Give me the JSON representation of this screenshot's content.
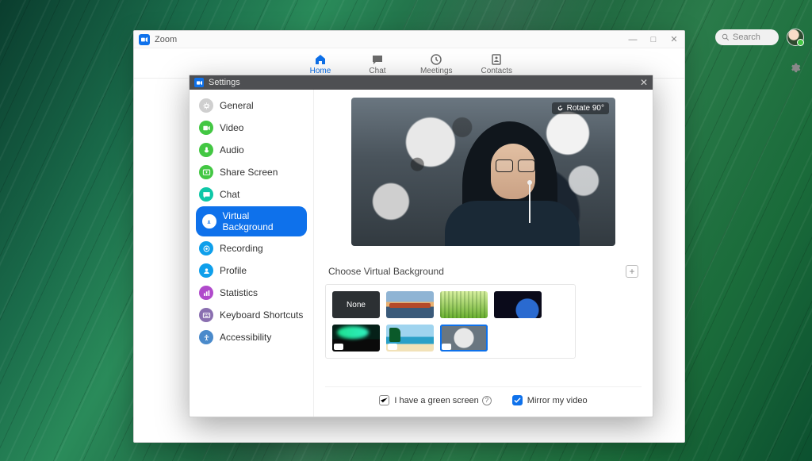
{
  "app": {
    "title": "Zoom"
  },
  "window_controls": {
    "minimize": "—",
    "maximize": "□",
    "close": "✕"
  },
  "nav": {
    "tabs": [
      {
        "id": "home",
        "label": "Home",
        "active": true
      },
      {
        "id": "chat",
        "label": "Chat"
      },
      {
        "id": "meetings",
        "label": "Meetings"
      },
      {
        "id": "contacts",
        "label": "Contacts"
      }
    ],
    "search_placeholder": "Search"
  },
  "settings": {
    "title": "Settings",
    "sidebar": [
      {
        "id": "general",
        "label": "General",
        "color": "#cfcfcf"
      },
      {
        "id": "video",
        "label": "Video",
        "color": "#43c743"
      },
      {
        "id": "audio",
        "label": "Audio",
        "color": "#43c743"
      },
      {
        "id": "share-screen",
        "label": "Share Screen",
        "color": "#43c743"
      },
      {
        "id": "chat",
        "label": "Chat",
        "color": "#0ec7a7"
      },
      {
        "id": "virtual-background",
        "label": "Virtual Background",
        "color": "#0e71eb",
        "selected": true
      },
      {
        "id": "recording",
        "label": "Recording",
        "color": "#0e9feb"
      },
      {
        "id": "profile",
        "label": "Profile",
        "color": "#0e9feb"
      },
      {
        "id": "statistics",
        "label": "Statistics",
        "color": "#b04acb"
      },
      {
        "id": "keyboard-shortcuts",
        "label": "Keyboard Shortcuts",
        "color": "#8a6fb0"
      },
      {
        "id": "accessibility",
        "label": "Accessibility",
        "color": "#4a8acb"
      }
    ],
    "preview": {
      "rotate_label": "Rotate 90°"
    },
    "choose_label": "Choose Virtual Background",
    "thumbs": [
      {
        "id": "none",
        "label": "None",
        "kind": "none"
      },
      {
        "id": "bridge",
        "kind": "bridge"
      },
      {
        "id": "grass",
        "kind": "grass"
      },
      {
        "id": "earth",
        "kind": "earth"
      },
      {
        "id": "aurora",
        "kind": "aurora",
        "camera": true
      },
      {
        "id": "beach",
        "kind": "beach",
        "camera": true
      },
      {
        "id": "blossom",
        "kind": "blossom",
        "camera": true,
        "selected": true
      }
    ],
    "footer": {
      "green_screen": {
        "label": "I have a green screen",
        "checked": false
      },
      "mirror": {
        "label": "Mirror my video",
        "checked": true
      }
    }
  }
}
